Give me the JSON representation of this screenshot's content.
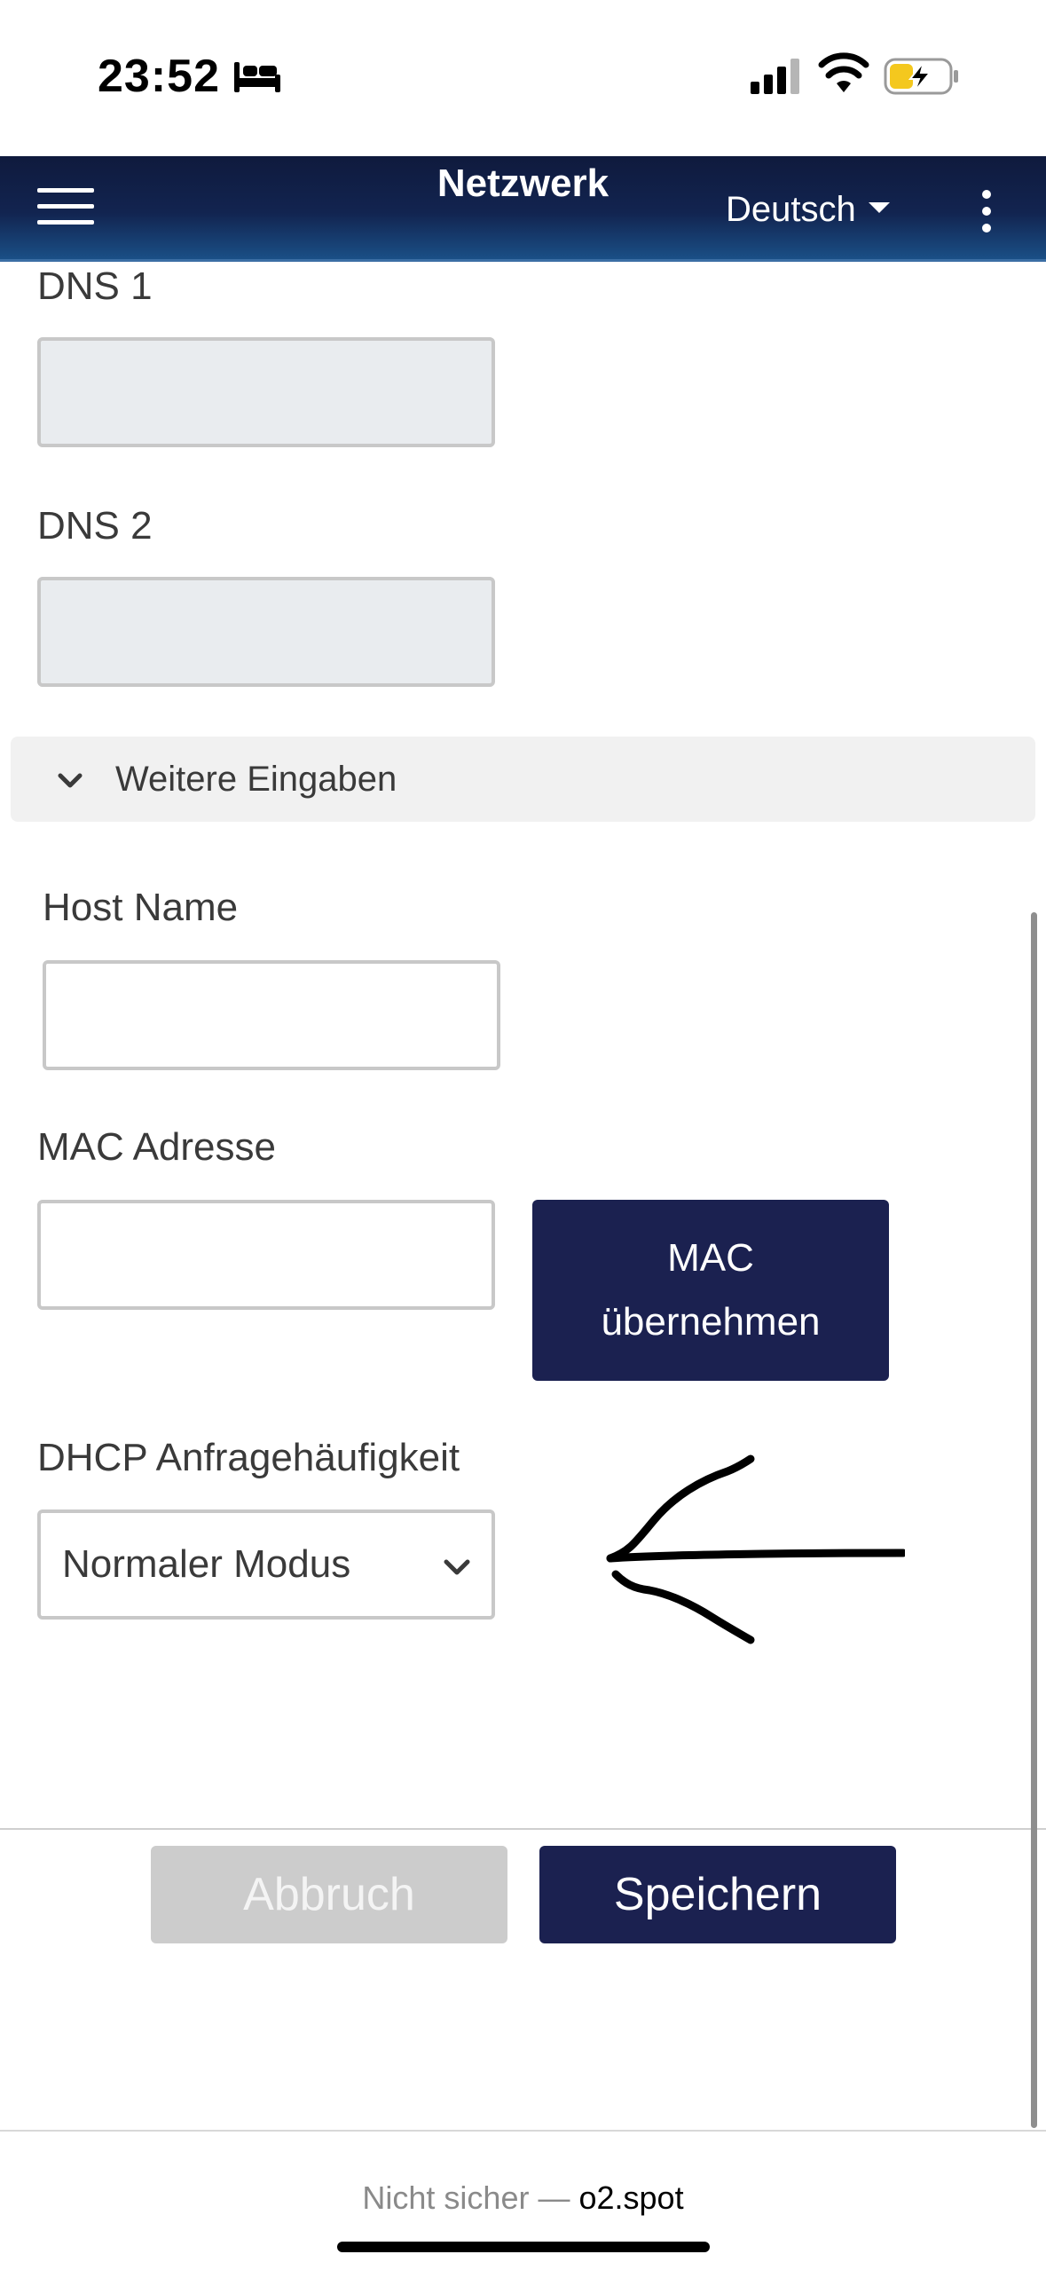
{
  "status_bar": {
    "time": "23:52",
    "icons": [
      "bed-icon",
      "cellular-signal-icon",
      "wifi-icon",
      "battery-charging-icon"
    ]
  },
  "app_bar": {
    "title": "Netzwerk",
    "language": "Deutsch",
    "icons": [
      "hamburger-menu-icon",
      "caret-down-icon",
      "more-vertical-icon"
    ]
  },
  "form": {
    "dns1": {
      "label": "DNS 1",
      "value": ""
    },
    "dns2": {
      "label": "DNS 2",
      "value": ""
    },
    "more_inputs_label": "Weitere Eingaben",
    "host_name": {
      "label": "Host Name",
      "value": ""
    },
    "mac_address": {
      "label": "MAC Adresse",
      "value": ""
    },
    "mac_button": {
      "line1": "MAC",
      "line2": "übernehmen"
    },
    "dhcp": {
      "label": "DHCP Anfragehäufigkeit",
      "selected": "Normaler Modus"
    }
  },
  "actions": {
    "cancel_label": "Abbruch",
    "save_label": "Speichern"
  },
  "browser_bar": {
    "security": "Nicht sicher —",
    "domain": "o2.spot"
  },
  "colors": {
    "app_bar_dark": "#0f1a3d",
    "app_bar_light": "#1a4f86",
    "primary_button": "#1b2150",
    "disabled_button": "#cccccc",
    "disabled_input": "#e9ecef"
  }
}
